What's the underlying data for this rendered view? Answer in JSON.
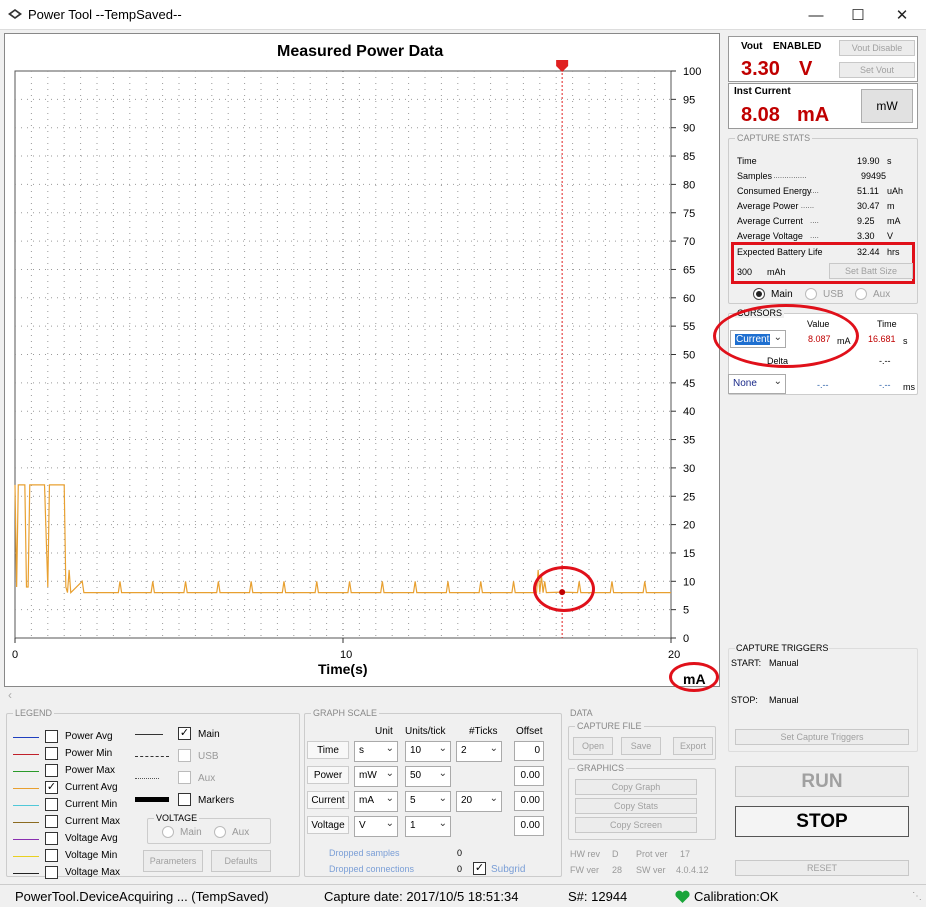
{
  "window": {
    "title": "Power Tool --TempSaved--"
  },
  "graph": {
    "title": "Measured Power Data",
    "xlabel": "Time(s)",
    "unit": "mA",
    "x_ticks": [
      "0",
      "10",
      "20"
    ],
    "y_ticks": [
      "0",
      "5",
      "10",
      "15",
      "20",
      "25",
      "30",
      "35",
      "40",
      "45",
      "50",
      "55",
      "60",
      "65",
      "70",
      "75",
      "80",
      "85",
      "90",
      "95",
      "100"
    ]
  },
  "chart_data": {
    "type": "line",
    "title": "Measured Power Data",
    "xlabel": "Time(s)",
    "ylabel": "mA",
    "xlim": [
      0,
      20
    ],
    "ylim": [
      0,
      100
    ],
    "grid": true,
    "cursor_x": 16.681,
    "series": [
      {
        "color": "#e8a030",
        "x": [
          0,
          0.05,
          0.1,
          0.3,
          0.35,
          0.4,
          0.45,
          0.5,
          0.6,
          0.7,
          0.8,
          0.9,
          1.0,
          1.05,
          1.1,
          1.2,
          1.4,
          1.5,
          1.55,
          1.6,
          1.65,
          1.7,
          2.05,
          2.1,
          3.15,
          3.2,
          3.25,
          4.15,
          4.2,
          4.25,
          5.15,
          5.2,
          5.25,
          6.15,
          6.2,
          6.25,
          7.15,
          7.2,
          7.25,
          8.15,
          8.2,
          8.25,
          9.15,
          9.2,
          9.25,
          10.15,
          10.2,
          10.25,
          11.15,
          11.2,
          11.25,
          12.15,
          12.2,
          12.25,
          13.15,
          13.2,
          13.25,
          14.15,
          14.2,
          14.25,
          15.15,
          15.2,
          15.25,
          15.9,
          15.95,
          16.0,
          16.05,
          16.1,
          16.15,
          16.2,
          16.681,
          17.15,
          17.2,
          17.25,
          18.15,
          18.2,
          18.25,
          19.15,
          19.2,
          19.25,
          20
        ],
        "y": [
          27,
          9,
          27,
          27,
          9,
          9,
          27,
          27,
          27,
          27,
          27,
          27,
          9,
          27,
          27,
          27,
          27,
          27,
          9,
          8,
          12,
          8,
          10,
          8,
          8,
          10,
          8,
          8,
          10,
          8,
          8,
          10,
          8,
          8,
          10,
          8,
          8,
          10,
          8,
          8,
          10,
          8,
          8,
          10,
          8,
          8,
          10,
          8,
          8,
          10,
          8,
          8,
          10,
          8,
          8,
          10,
          8,
          8,
          10,
          8,
          8,
          10,
          8,
          8,
          12,
          8,
          11,
          8,
          10,
          8,
          8.09,
          8,
          10,
          8,
          8,
          10,
          8,
          8,
          10,
          8,
          8
        ]
      }
    ]
  },
  "vout": {
    "label": "Vout",
    "state": "ENABLED",
    "value": "3.30",
    "unit": "V",
    "btn_disable": "Vout Disable",
    "btn_set": "Set Vout"
  },
  "inst": {
    "label": "Inst Current",
    "value": "8.08",
    "unit": "mA",
    "btn_unit": "mW"
  },
  "stats": {
    "group": "CAPTURE STATS",
    "rows": [
      {
        "label": "Time",
        "dots": "",
        "value": "19.90",
        "unit": "s"
      },
      {
        "label": "Samples",
        "dots": "...............",
        "value": "99495",
        "unit": ""
      },
      {
        "label": "Consumed Energy",
        "dots": "....",
        "value": "51.11",
        "unit": "uAh"
      },
      {
        "label": "Average Power",
        "dots": "......",
        "value": "30.47",
        "unit": "m"
      },
      {
        "label": "Average Current",
        "dots": "....",
        "value": "9.25",
        "unit": "mA"
      },
      {
        "label": "Average Voltage",
        "dots": "....",
        "value": "3.30",
        "unit": "V"
      }
    ],
    "battery_label": "Expected Battery Life",
    "battery_value": "32.44",
    "battery_unit": "hrs",
    "batt_size": "300",
    "batt_unit": "mAh",
    "btn_batt": "Set Batt Size",
    "radio_main": "Main",
    "radio_usb": "USB",
    "radio_aux": "Aux"
  },
  "cursors": {
    "group": "CURSORS",
    "col_value": "Value",
    "col_time": "Time",
    "select1": "Current",
    "value1": "8.087",
    "unit1": "mA",
    "time1": "16.681",
    "tunit1": "s",
    "delta": "Delta",
    "delta_val": "-.--",
    "select2": "None",
    "value2": "-.--",
    "time2": "-.--",
    "tunit2": "ms"
  },
  "triggers": {
    "group": "CAPTURE TRIGGERS",
    "start_label": "START:",
    "start_val": "Manual",
    "stop_label": "STOP:",
    "stop_val": "Manual",
    "btn": "Set Capture Triggers"
  },
  "run": {
    "run": "RUN",
    "stop": "STOP",
    "reset": "RESET"
  },
  "legend": {
    "group": "LEGEND",
    "items": [
      {
        "label": "Power Avg",
        "color": "#1f3fbf",
        "checked": false
      },
      {
        "label": "Power Min",
        "color": "#c0202a",
        "checked": false
      },
      {
        "label": "Power Max",
        "color": "#2a9a2a",
        "checked": false
      },
      {
        "label": "Current Avg",
        "color": "#e8a030",
        "checked": true
      },
      {
        "label": "Current Min",
        "color": "#50c8d8",
        "checked": false
      },
      {
        "label": "Current Max",
        "color": "#8b6b20",
        "checked": false
      },
      {
        "label": "Voltage Avg",
        "color": "#8a2fb0",
        "checked": false
      },
      {
        "label": "Voltage Min",
        "color": "#e8d020",
        "checked": false
      },
      {
        "label": "Voltage Max",
        "color": "#222222",
        "checked": false
      }
    ],
    "main": "Main",
    "usb": "USB",
    "aux": "Aux",
    "markers": "Markers",
    "voltage_group": "VOLTAGE",
    "v_main": "Main",
    "v_aux": "Aux",
    "btn_params": "Parameters",
    "btn_defaults": "Defaults"
  },
  "scale": {
    "group": "GRAPH SCALE",
    "h_unit": "Unit",
    "h_upt": "Units/tick",
    "h_ticks": "#Ticks",
    "h_offset": "Offset",
    "rows": [
      {
        "label": "Time",
        "unit": "s",
        "upt": "10",
        "ticks": "2",
        "offset": "0"
      },
      {
        "label": "Power",
        "unit": "mW",
        "upt": "50",
        "ticks": "",
        "offset": "0.00"
      },
      {
        "label": "Current",
        "unit": "mA",
        "upt": "5",
        "ticks": "20",
        "offset": "0.00"
      },
      {
        "label": "Voltage",
        "unit": "V",
        "upt": "1",
        "ticks": "",
        "offset": "0.00"
      }
    ],
    "dropped_samples": "Dropped samples",
    "ds_val": "0",
    "dropped_conn": "Dropped connections",
    "dc_val": "0",
    "subgrid": "Subgrid"
  },
  "data": {
    "group": "DATA",
    "file_group": "CAPTURE FILE",
    "open": "Open",
    "save": "Save",
    "export": "Export",
    "graphics_group": "GRAPHICS",
    "copy_graph": "Copy Graph",
    "copy_stats": "Copy Stats",
    "copy_screen": "Copy Screen",
    "hw_rev_l": "HW rev",
    "hw_rev": "D",
    "prot_ver_l": "Prot ver",
    "prot_ver": "17",
    "fw_ver_l": "FW ver",
    "fw_ver": "28",
    "sw_ver_l": "SW ver",
    "sw_ver": "4.0.4.12"
  },
  "status": {
    "state": "PowerTool.DeviceAcquiring ... (TempSaved)",
    "capture": "Capture date: 2017/10/5 18:51:34",
    "serial": "S#: 12944",
    "calib": "Calibration:OK"
  }
}
